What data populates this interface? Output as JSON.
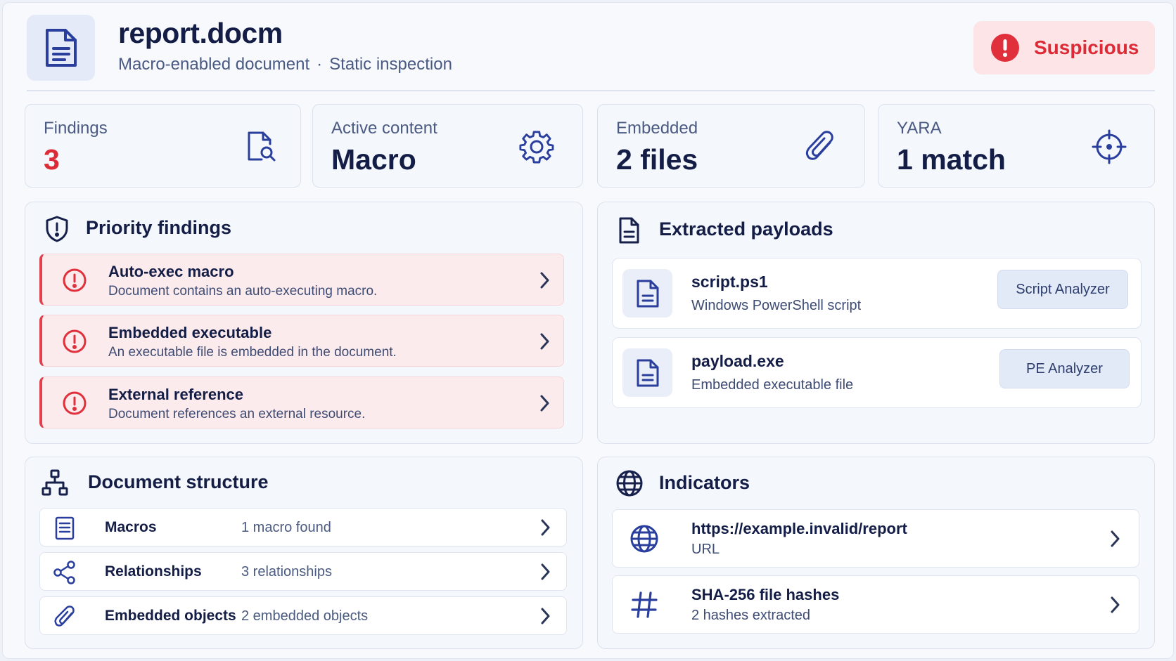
{
  "header": {
    "file_name": "report.docm",
    "file_type": "Macro-enabled document",
    "separator": "·",
    "mode": "Static inspection",
    "doc_icon": "document-icon",
    "verdict": {
      "label": "Suspicious",
      "icon": "alert-circle-icon",
      "color": "#dc2b36"
    }
  },
  "stats": [
    {
      "label": "Findings",
      "value": "3",
      "icon": "file-search-icon"
    },
    {
      "label": "Active content",
      "value": "Macro",
      "icon": "gear-icon"
    },
    {
      "label": "Embedded",
      "value": "2 files",
      "icon": "paperclip-icon"
    },
    {
      "label": "YARA",
      "value": "1 match",
      "icon": "crosshair-icon"
    }
  ],
  "priority_findings": {
    "title": "Priority findings",
    "icon": "shield-alert-icon",
    "items": [
      {
        "title": "Auto-exec macro",
        "description": "Document contains an auto-executing macro."
      },
      {
        "title": "Embedded executable",
        "description": "An executable file is embedded in the document."
      },
      {
        "title": "External reference",
        "description": "Document references an external resource."
      }
    ]
  },
  "payloads": {
    "title": "Extracted payloads",
    "icon": "document-icon",
    "items": [
      {
        "name": "script.ps1",
        "description": "Windows PowerShell script",
        "action": "Script Analyzer"
      },
      {
        "name": "payload.exe",
        "description": "Embedded executable file",
        "action": "PE Analyzer"
      }
    ]
  },
  "structure": {
    "title": "Document structure",
    "icon": "hierarchy-icon",
    "items": [
      {
        "name": "Macros",
        "value": "1 macro found",
        "icon": "document-lines-icon"
      },
      {
        "name": "Relationships",
        "value": "3 relationships",
        "icon": "share-icon"
      },
      {
        "name": "Embedded objects",
        "value": "2 embedded objects",
        "icon": "paperclip-icon"
      }
    ]
  },
  "indicators": {
    "title": "Indicators",
    "icon": "globe-icon",
    "items": [
      {
        "value": "https://example.invalid/report",
        "type": "URL",
        "icon": "globe-icon"
      },
      {
        "value": "SHA-256 file hashes",
        "type": "2 hashes extracted",
        "icon": "hash-icon"
      }
    ]
  },
  "colors": {
    "accent": "#2a3f9d",
    "danger": "#dc2b36",
    "danger_bg": "#fcebed"
  }
}
